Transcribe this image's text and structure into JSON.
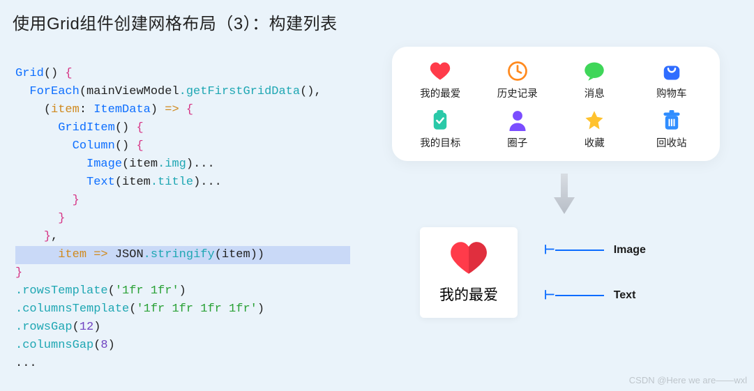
{
  "title": "使用Grid组件创建网格布局（3）：构建列表",
  "code": {
    "l1a": "Grid",
    "l1b": "() ",
    "l2a": "ForEach",
    "l2b": "(mainViewModel",
    "l2c": ".getFirstGridData",
    "l2d": "(),",
    "l3a": "(",
    "l3b": "item",
    "l3c": ": ",
    "l3d": "ItemData",
    "l3e": ") ",
    "l3arrow": "=>",
    "l4a": "GridItem",
    "l4b": "() ",
    "l5a": "Column",
    "l5b": "() ",
    "l6a": "Image",
    "l6b": "(item",
    "l6c": ".img",
    "l6d": ")",
    "l6e": "...",
    "l7a": "Text",
    "l7b": "(item",
    "l7c": ".title",
    "l7d": ")",
    "l7e": "...",
    "l10a": "item",
    "l10arrow": " => ",
    "l10b": "JSON",
    "l10c": ".stringify",
    "l10d": "(item))",
    "l12a": ".rowsTemplate",
    "l12b": "(",
    "l12c": "'1fr 1fr'",
    "l12d": ")",
    "l13a": ".columnsTemplate",
    "l13b": "(",
    "l13c": "'1fr 1fr 1fr 1fr'",
    "l13d": ")",
    "l14a": ".rowsGap",
    "l14b": "(",
    "l14c": "12",
    "l14d": ")",
    "l15a": ".columnsGap",
    "l15b": "(",
    "l15c": "8",
    "l15d": ")",
    "ellipsis": "..."
  },
  "grid": {
    "items": [
      {
        "label": "我的最爱",
        "icon": "heart"
      },
      {
        "label": "历史记录",
        "icon": "clock"
      },
      {
        "label": "消息",
        "icon": "chat"
      },
      {
        "label": "购物车",
        "icon": "bag"
      },
      {
        "label": "我的目标",
        "icon": "clipboard"
      },
      {
        "label": "圈子",
        "icon": "person"
      },
      {
        "label": "收藏",
        "icon": "star"
      },
      {
        "label": "回收站",
        "icon": "trash"
      }
    ]
  },
  "detail": {
    "text": "我的最爱",
    "label_image": "Image",
    "label_text": "Text"
  },
  "watermark": "CSDN @Here we are——wxl",
  "colors": {
    "heart": "#ff3b4a",
    "clock": "#ff8a1f",
    "chat": "#3fd659",
    "bag": "#2f6dff",
    "clipboard": "#2ac9a8",
    "person": "#7b4dff",
    "star": "#ffc22e",
    "trash": "#2f8dff"
  }
}
